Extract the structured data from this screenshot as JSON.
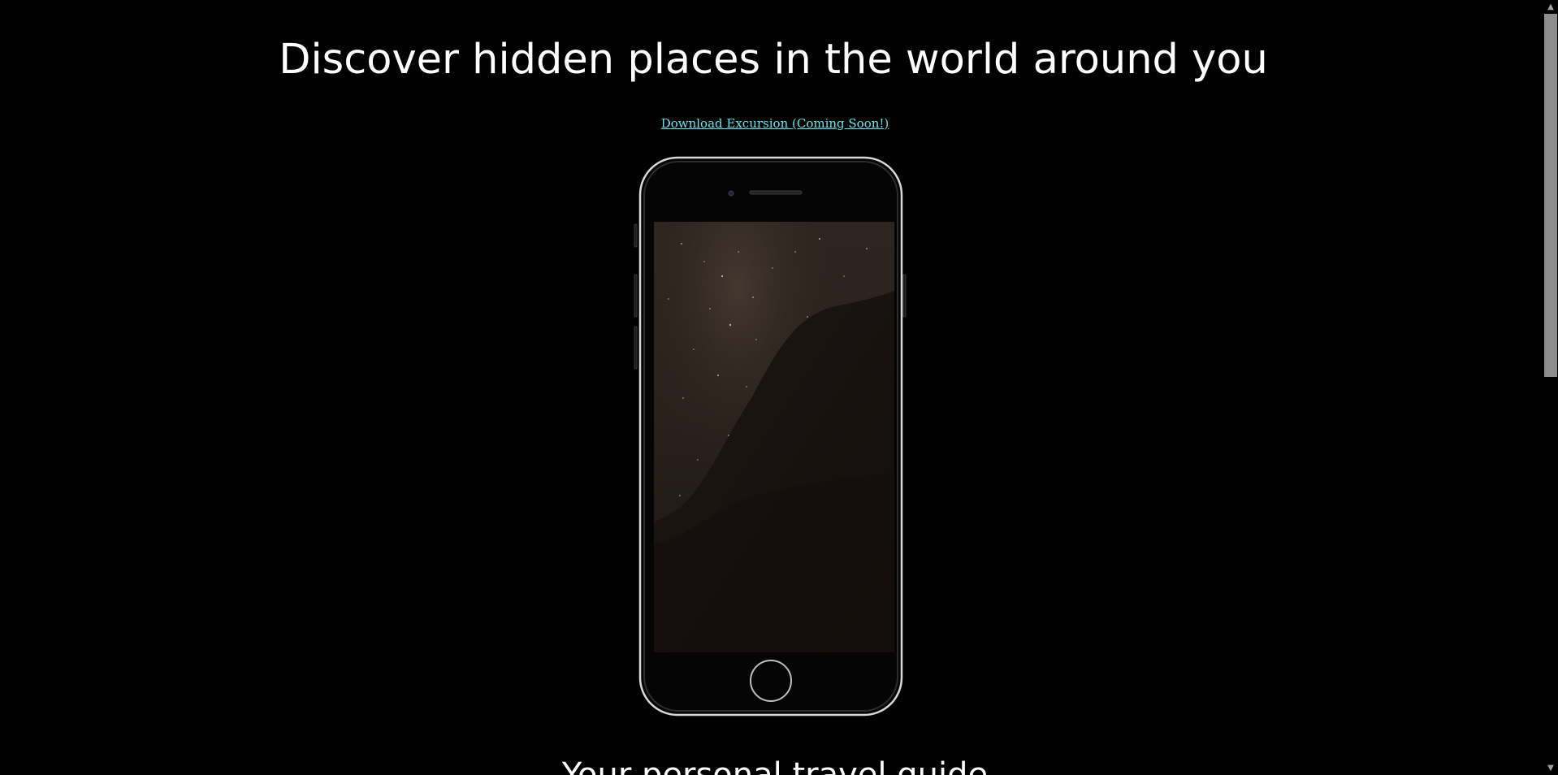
{
  "hero": {
    "title": "Discover hidden places in the world around you",
    "download_link": "Download Excursion (Coming Soon!)"
  },
  "phone_mockup": {
    "icon": "phone-frame-icon",
    "screen_content": "night-sky-video"
  },
  "next_section": {
    "title": "Your personal travel guide"
  },
  "scrollbar": {
    "up_icon": "chevron-up-icon",
    "down_icon": "chevron-down-icon"
  },
  "colors": {
    "background": "#000000",
    "text": "#ffffff",
    "link": "#5fe8f0",
    "scroll_thumb": "#8d8d8d"
  }
}
